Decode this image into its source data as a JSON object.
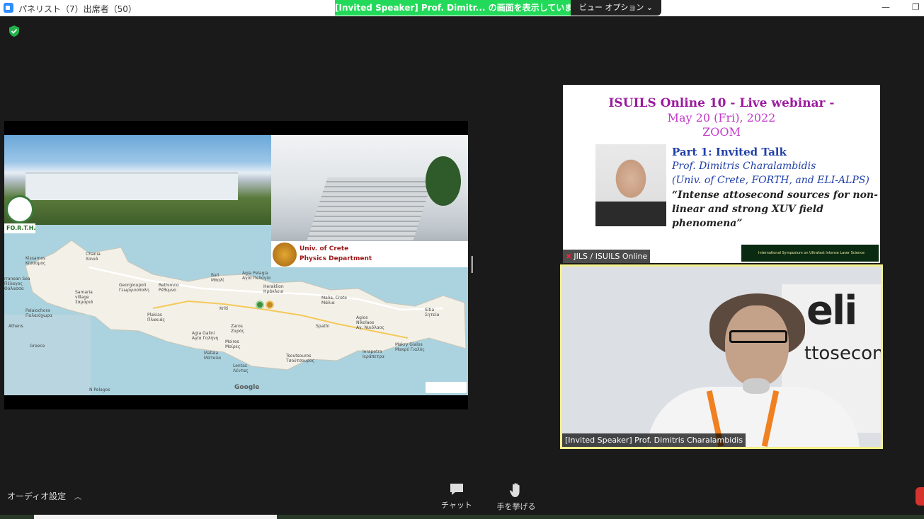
{
  "window": {
    "title": "パネリスト（7）出席者（50）",
    "minimize_glyph": "—",
    "maximize_glyph": "❐"
  },
  "banner": {
    "share_text": "[Invited Speaker]  Prof. Dimitr... の画面を表示しています",
    "view_options": "ビュー オプション ⌄"
  },
  "shared_screen": {
    "forth_label": "FO.R.T.H.",
    "uoc_line1": "Univ. of Crete",
    "uoc_line2": "Physics Department",
    "google_label": "Google",
    "map_labels": {
      "chania": "Chania\nΧανιά",
      "kissamos": "Kissamos\nΚίσσαμος",
      "georgioupoli": "Georgioupoli\nΓεωργιούπολη",
      "rethimno": "Rethimno\nΡέθυμνο",
      "bali": "Bali\nΜπαλί",
      "agia_pelagia": "Agia Pelagia\nΑγία Πελαγία",
      "heraklion": "Heraklion\nΗράκλειο",
      "malia": "Malia, Crete\nΜάλια",
      "sitia": "Sitia\nΣητεία",
      "samaria": "Samaria\nvillage\nΣαμαριά",
      "plakias": "Plakias\nΠλακιάς",
      "kriti": "Kriti",
      "zaros": "Zaros\nΖαρός",
      "agia_galini": "Agia Galini\nΑγία Γαλήνη",
      "moires": "Moires\nΜοίρες",
      "spathi": "Spathi",
      "agios_nikolaos": "Agios\nNikolaos\nΑγ. Νικόλαος",
      "ierapetra": "Ierapetra\nΙεράπετρα",
      "makry_gialos": "Makry Gialos\nΜακρύ Γιαλός",
      "tsoutsouros": "Tsoutsouros\nΤσούτσουρος",
      "matala": "Matala\nΜάταλα",
      "lentas": "Lentas\nΛέντας",
      "palaiochora": "Palaiochora\nΠαλαιόχωρα",
      "athens": "Athens",
      "greece": "Greece",
      "sea": "rranean Sea\nΠέλαγος\nΘάλασσα",
      "pelagos": "Ν Pelagos"
    }
  },
  "webinar_slide": {
    "line1": "ISUILS Online 10 - Live webinar -",
    "line2": "May 20 (Fri), 2022",
    "line3": "ZOOM",
    "part": "Part 1: Invited Talk",
    "speaker": "Prof. Dimitris Charalambidis",
    "affiliation": "(Univ. of Crete, FORTH, and ELI-ALPS)",
    "talk_line1": "“Intense attosecond sources for non-",
    "talk_line2": "linear and strong XUV field",
    "talk_line3": "phenomena”",
    "logo_text": "International Symposium on Ultrafast Intense Laser Science"
  },
  "tiles": {
    "top_name": "JILS / ISUILS Online",
    "bottom_name": "[Invited Speaker] Prof. Dimitris Charalambidis",
    "eli_logo": "eli",
    "eli_sub": "ttosecond"
  },
  "toolbar": {
    "audio_settings": "オーディオ設定",
    "chat": "チャット",
    "raise_hand": "手を挙げる"
  },
  "colors": {
    "share_banner": "#23d959",
    "slide_title": "#9b1b9e",
    "slide_blue": "#1f3fa8",
    "active_speaker_border": "#f3ef8a",
    "leave_button": "#d6332f"
  }
}
